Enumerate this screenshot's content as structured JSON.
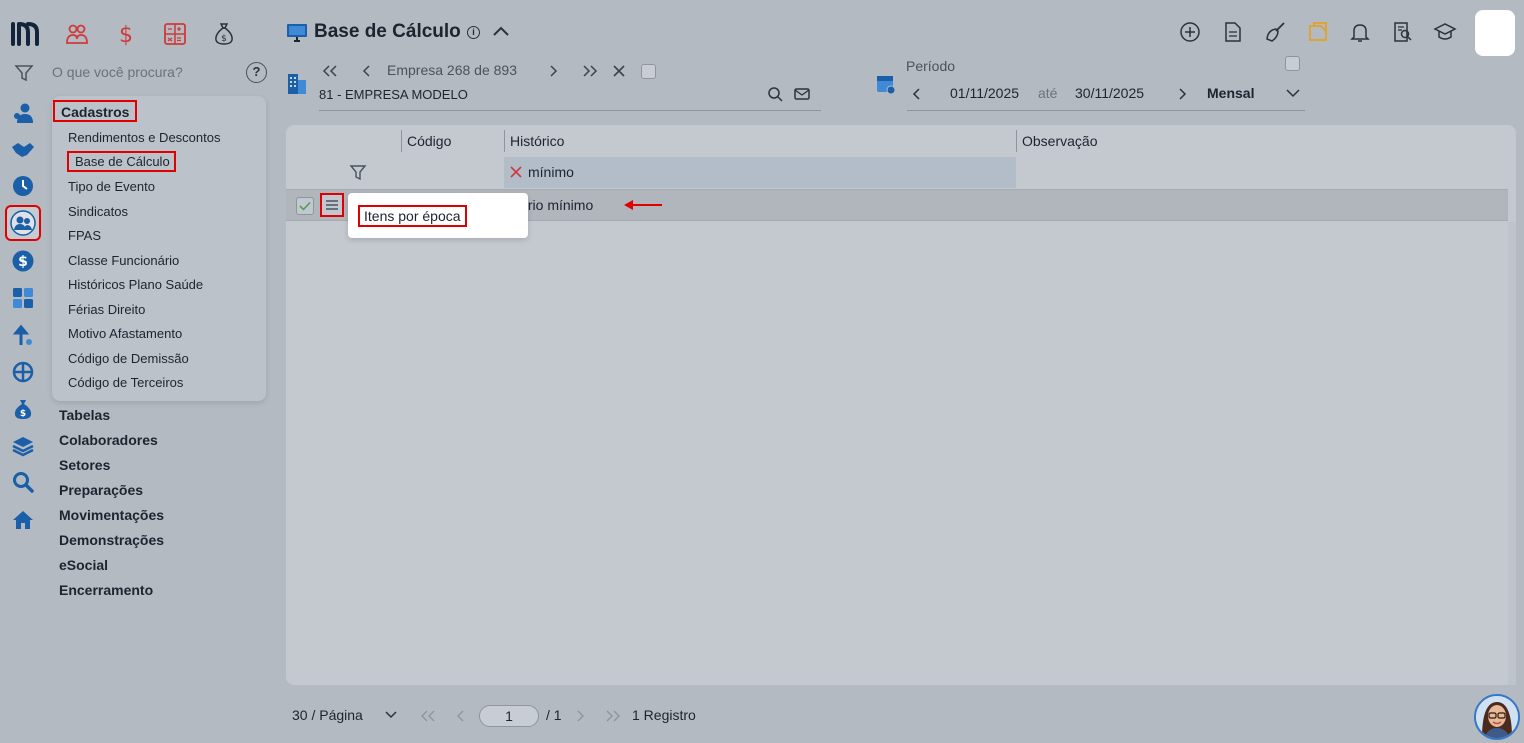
{
  "colors": {
    "background": "#b4bac2",
    "highlight_border": "#e00000",
    "accent_blue": "#1a5fa8",
    "module_red": "#cf3a3a",
    "notes_orange": "#e3a12a"
  },
  "top_modules": [
    {
      "icon": "people-icon"
    },
    {
      "icon": "dollar-icon"
    },
    {
      "icon": "calculator-grid-icon"
    },
    {
      "icon": "money-bag-icon"
    }
  ],
  "sidebar": {
    "search_placeholder": "O que você procura?",
    "rail_icons": [
      "person-icon",
      "handshake-icon",
      "clock-icon",
      "team-icon",
      "dollar-circle-icon",
      "calculator-icon",
      "growth-icon",
      "network-icon",
      "money-bag-icon",
      "layers-icon",
      "search-icon",
      "home-icon"
    ],
    "submenu": {
      "title": "Cadastros",
      "items": [
        "Rendimentos e Descontos",
        "Base de Cálculo",
        "Tipo de Evento",
        "Sindicatos",
        "FPAS",
        "Classe Funcionário",
        "Históricos Plano Saúde",
        "Férias Direito",
        "Motivo Afastamento",
        "Código de Demissão",
        "Código de Terceiros"
      ]
    },
    "nav": [
      "Tabelas",
      "Colaboradores",
      "Setores",
      "Preparações",
      "Movimentações",
      "Demonstrações",
      "eSocial",
      "Encerramento"
    ]
  },
  "header": {
    "title": "Base de Cálculo",
    "actions": [
      "plus-circle-icon",
      "document-icon",
      "broom-icon",
      "notes-icon",
      "bell-icon",
      "report-search-icon",
      "graduation-cap-icon"
    ]
  },
  "toolbar": {
    "empresa_counter": "Empresa 268 de 893",
    "empresa_name": "81 - EMPRESA MODELO",
    "periodo_label": "Período",
    "start_date": "01/11/2025",
    "ate": "até",
    "end_date": "30/11/2025",
    "period_type": "Mensal"
  },
  "grid": {
    "columns": [
      "Código",
      "Histórico",
      "Observação"
    ],
    "filter_value": "mínimo",
    "rows": [
      {
        "codigo": "",
        "historico": "lário mínimo",
        "observacao": ""
      }
    ],
    "context_menu": [
      "Itens por época"
    ]
  },
  "footer": {
    "page_size": "30 / Página",
    "current_page": "1",
    "total_pages": "/ 1",
    "records": "1 Registro"
  }
}
